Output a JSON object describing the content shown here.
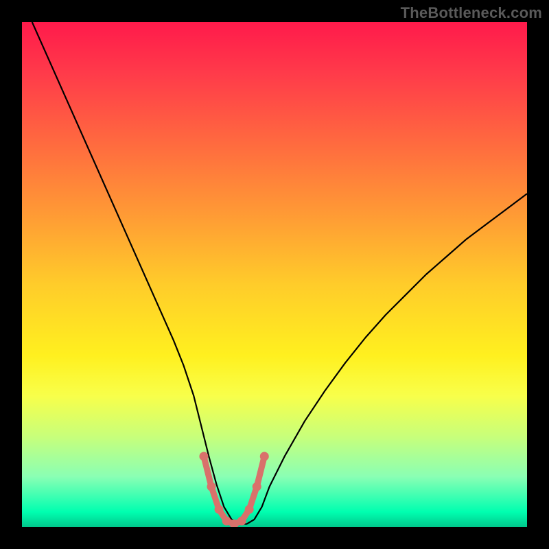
{
  "watermark": "TheBottleneck.com",
  "chart_data": {
    "type": "line",
    "title": "",
    "xlabel": "",
    "ylabel": "",
    "xlim": [
      0,
      100
    ],
    "ylim": [
      0,
      100
    ],
    "grid": false,
    "legend": false,
    "series": [
      {
        "name": "curve",
        "color": "#000000",
        "x": [
          2,
          6,
          10,
          14,
          18,
          22,
          26,
          30,
          32,
          34,
          35.5,
          37,
          38.5,
          40,
          41.5,
          43,
          44.5,
          46,
          47.5,
          49,
          52,
          56,
          60,
          64,
          68,
          72,
          76,
          80,
          84,
          88,
          92,
          96,
          100
        ],
        "values": [
          100,
          91,
          82,
          73,
          64,
          55,
          46,
          37,
          32,
          26,
          20,
          14,
          8.5,
          4,
          1.5,
          0.6,
          0.6,
          1.5,
          4,
          8,
          14,
          21,
          27,
          32.5,
          37.5,
          42,
          46,
          50,
          53.5,
          57,
          60,
          63,
          66
        ]
      },
      {
        "name": "valley-highlight",
        "color": "#d9716b",
        "x": [
          36,
          37.5,
          39,
          40.5,
          42,
          43.5,
          45,
          46.5,
          48
        ],
        "values": [
          14,
          8,
          3.5,
          1.2,
          0.6,
          1.2,
          3.5,
          8,
          14
        ]
      }
    ],
    "colors": {
      "background_gradient_top": "#ff1a4b",
      "background_gradient_bottom": "#00c88c",
      "curve": "#000000",
      "highlight": "#d9716b",
      "frame": "#000000"
    }
  }
}
